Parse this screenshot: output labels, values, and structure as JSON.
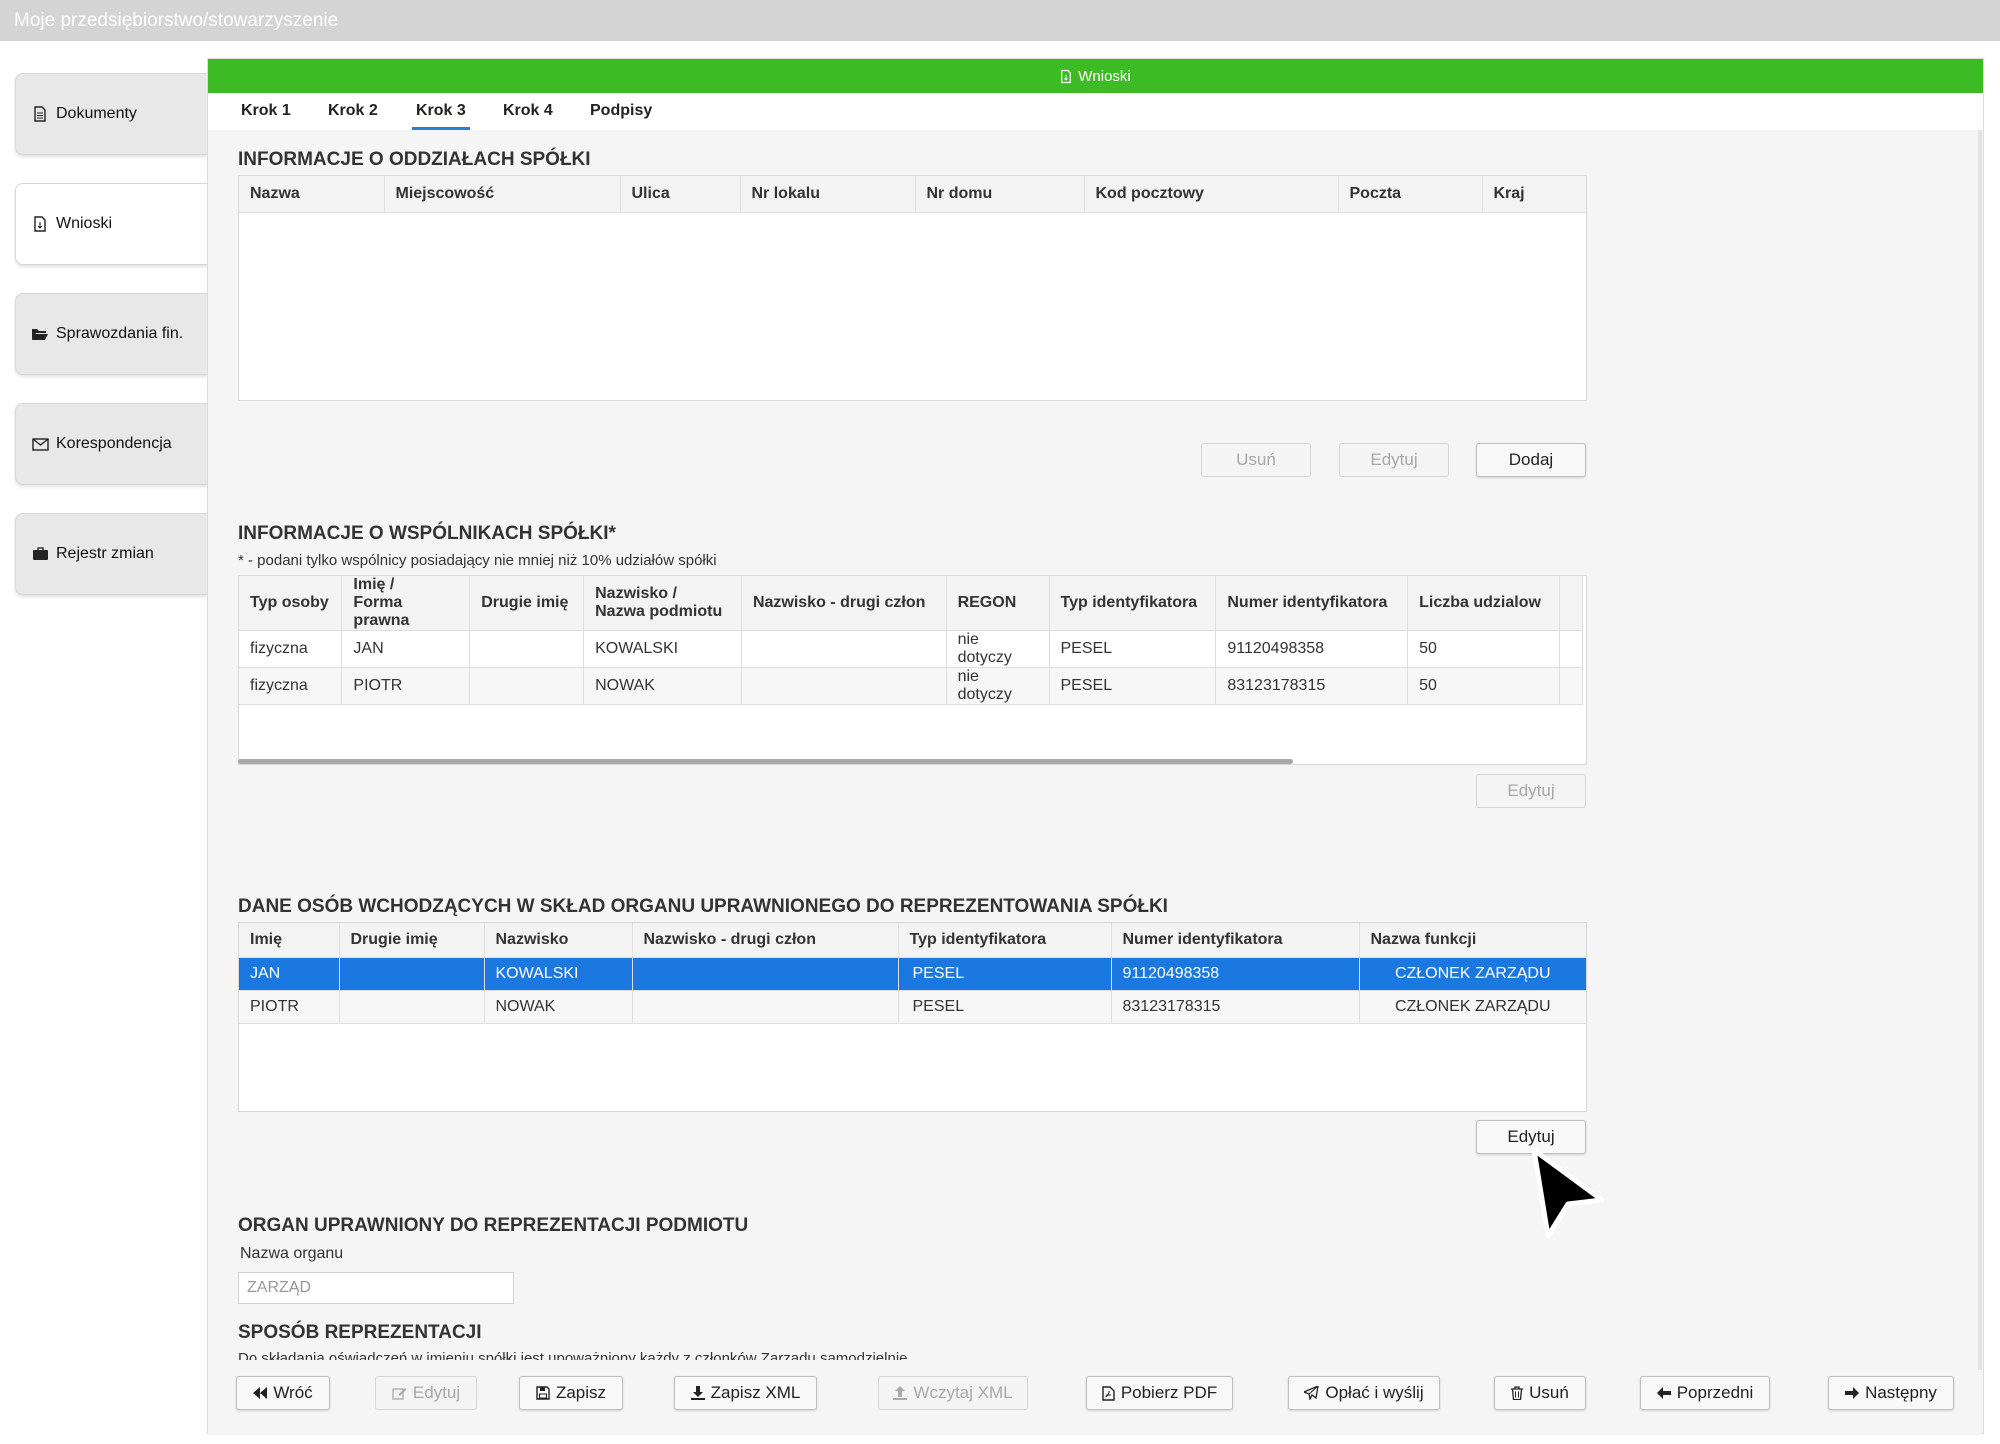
{
  "window": {
    "title": "Moje przedsiębiorstwo/stowarzyszenie"
  },
  "sidebar": {
    "items": [
      {
        "label": "Dokumenty",
        "icon": "document-icon"
      },
      {
        "label": "Wnioski",
        "icon": "file-icon"
      },
      {
        "label": "Sprawozdania fin.",
        "icon": "folder-open-icon"
      },
      {
        "label": "Korespondencja",
        "icon": "envelope-icon"
      },
      {
        "label": "Rejestr zmian",
        "icon": "briefcase-icon"
      }
    ]
  },
  "panel": {
    "title": "Wnioski",
    "accent": "#3dbb24"
  },
  "tabs": [
    {
      "label": "Krok 1"
    },
    {
      "label": "Krok 2"
    },
    {
      "label": "Krok 3",
      "active": true
    },
    {
      "label": "Krok 4"
    },
    {
      "label": "Podpisy"
    }
  ],
  "branches": {
    "title": "INFORMACJE O ODDZIAŁACH SPÓŁKI",
    "columns": [
      "Nazwa",
      "Miejscowość",
      "Ulica",
      "Nr lokalu",
      "Nr domu",
      "Kod pocztowy",
      "Poczta",
      "Kraj"
    ],
    "buttons": {
      "remove": "Usuń",
      "edit": "Edytuj",
      "add": "Dodaj"
    }
  },
  "partners": {
    "title": "INFORMACJE O WSPÓLNIKACH SPÓŁKI*",
    "note": "* - podani tylko wspólnicy posiadający nie mniej niż 10% udziałów spółki",
    "columns": [
      "Typ osoby",
      "Imię / Forma prawna",
      "Drugie imię",
      "Nazwisko / Nazwa podmiotu",
      "Nazwisko - drugi człon",
      "REGON",
      "Typ identyfikatora",
      "Numer identyfikatora",
      "Liczba udzialow"
    ],
    "col_lines": [
      [
        "Typ osoby"
      ],
      [
        "Imię /",
        "Forma prawna"
      ],
      [
        "Drugie imię"
      ],
      [
        "Nazwisko /",
        "Nazwa podmiotu"
      ],
      [
        "Nazwisko - drugi człon"
      ],
      [
        "REGON"
      ],
      [
        "Typ identyfikatora"
      ],
      [
        "Numer identyfikatora"
      ],
      [
        "Liczba udzialow"
      ]
    ],
    "rows": [
      [
        "fizyczna",
        "JAN",
        "",
        "KOWALSKI",
        "",
        "nie dotyczy",
        "PESEL",
        "91120498358",
        "50"
      ],
      [
        "fizyczna",
        "PIOTR",
        "",
        "NOWAK",
        "",
        "nie dotyczy",
        "PESEL",
        "83123178315",
        "50"
      ]
    ],
    "buttons": {
      "edit": "Edytuj"
    }
  },
  "board": {
    "title": "DANE OSÓB WCHODZĄCYCH W SKŁAD ORGANU UPRAWNIONEGO DO REPREZENTOWANIA SPÓŁKI",
    "columns": [
      "Imię",
      "Drugie imię",
      "Nazwisko",
      "Nazwisko - drugi człon",
      "Typ identyfikatora",
      "Numer identyfikatora",
      "Nazwa funkcji"
    ],
    "rows": [
      [
        "JAN",
        "",
        "KOWALSKI",
        "",
        "PESEL",
        "91120498358",
        "CZŁONEK ZARZĄDU"
      ],
      [
        "PIOTR",
        "",
        "NOWAK",
        "",
        "PESEL",
        "83123178315",
        "CZŁONEK ZARZĄDU"
      ]
    ],
    "selected_row": 0,
    "selection_color": "#1a78e0",
    "buttons": {
      "edit": "Edytuj"
    }
  },
  "organ": {
    "title": "ORGAN UPRAWNIONY DO REPREZENTACJI PODMIOTU",
    "field_label": "Nazwa organu",
    "field_value": "ZARZĄD"
  },
  "representation": {
    "title": "SPOSÓB REPREZENTACJI",
    "text": "Do składania oświadczeń w imieniu spółki jest upoważniony każdy z członków Zarządu samodzielnie."
  },
  "toolbar": {
    "back": "Wróć",
    "edit": "Edytuj",
    "save": "Zapisz",
    "save_xml": "Zapisz XML",
    "load_xml": "Wczytaj XML",
    "download_pdf": "Pobierz PDF",
    "pay_send": "Opłać i wyślij",
    "delete": "Usuń",
    "previous": "Poprzedni",
    "next": "Następny"
  }
}
